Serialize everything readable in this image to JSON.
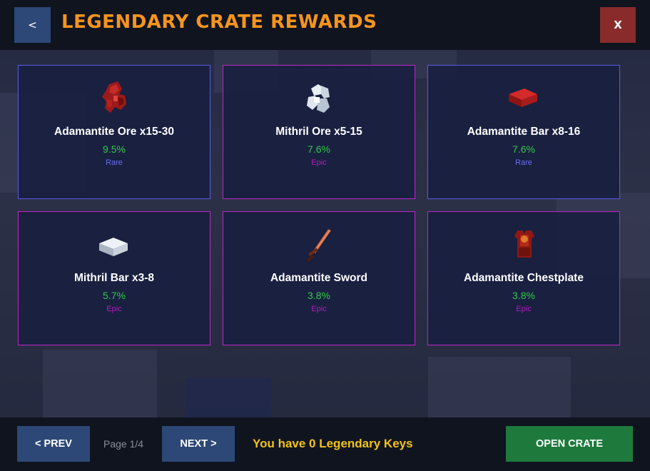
{
  "header": {
    "back_label": "<",
    "title": "LEGENDARY CRATE REWARDS",
    "close_label": "X"
  },
  "rewards": [
    {
      "name": "Adamantite Ore x15-30",
      "chance": "9.5%",
      "rarity": "Rare",
      "icon": "adamantite-ore-icon"
    },
    {
      "name": "Mithril Ore x5-15",
      "chance": "7.6%",
      "rarity": "Epic",
      "icon": "mithril-ore-icon"
    },
    {
      "name": "Adamantite Bar x8-16",
      "chance": "7.6%",
      "rarity": "Rare",
      "icon": "adamantite-bar-icon"
    },
    {
      "name": "Mithril Bar x3-8",
      "chance": "5.7%",
      "rarity": "Epic",
      "icon": "mithril-bar-icon"
    },
    {
      "name": "Adamantite Sword",
      "chance": "3.8%",
      "rarity": "Epic",
      "icon": "adamantite-sword-icon"
    },
    {
      "name": "Adamantite Chestplate",
      "chance": "3.8%",
      "rarity": "Epic",
      "icon": "adamantite-chestplate-icon"
    }
  ],
  "colors": {
    "title": "#f7941d",
    "rare": "#5a5ce8",
    "epic": "#c026c8",
    "chance": "#35c94a",
    "keys": "#f2c318",
    "open_button": "#1e7a3c",
    "close_button": "#8a2b2b"
  },
  "footer": {
    "prev_label": "< PREV",
    "page_indicator": "Page 1/4",
    "next_label": "NEXT >",
    "keys_text": "You have 0 Legendary Keys",
    "open_label": "OPEN CRATE"
  }
}
